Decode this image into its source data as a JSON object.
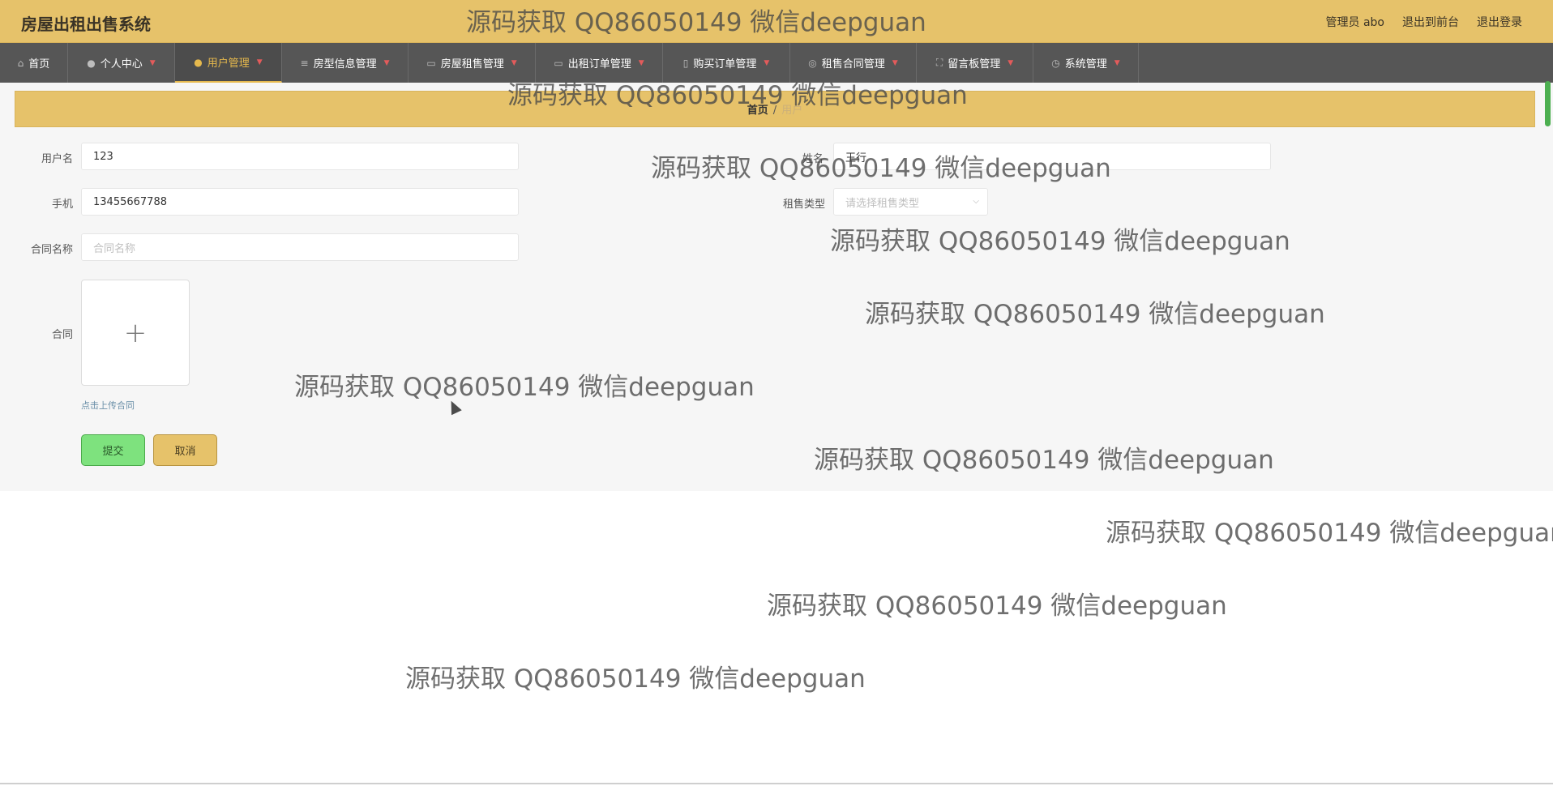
{
  "app": {
    "title": "房屋出租出售系统"
  },
  "top_links": {
    "admin": "管理员 abo",
    "to_front": "退出到前台",
    "logout": "退出登录"
  },
  "nav": [
    {
      "label": "首页",
      "icon": "home-icon",
      "glyph": "⌂"
    },
    {
      "label": "个人中心",
      "icon": "user-icon",
      "glyph": "●"
    },
    {
      "label": "用户管理",
      "icon": "user-icon",
      "glyph": "●",
      "active": true
    },
    {
      "label": "房型信息管理",
      "icon": "list-icon",
      "glyph": "≡"
    },
    {
      "label": "房屋租售管理",
      "icon": "chat-icon",
      "glyph": "▭"
    },
    {
      "label": "出租订单管理",
      "icon": "message-icon",
      "glyph": "▭"
    },
    {
      "label": "购买订单管理",
      "icon": "mic-icon",
      "glyph": "▯"
    },
    {
      "label": "租售合同管理",
      "icon": "compass-icon",
      "glyph": "◎"
    },
    {
      "label": "留言板管理",
      "icon": "fullscreen-icon",
      "glyph": "⛶"
    },
    {
      "label": "系统管理",
      "icon": "clock-icon",
      "glyph": "◷"
    }
  ],
  "breadcrumb": {
    "home": "首页",
    "sep": "/",
    "current": "用户"
  },
  "form": {
    "username_label": "用户名",
    "username_value": "123",
    "name_label": "姓名",
    "name_value": "王行",
    "phone_label": "手机",
    "phone_value": "13455667788",
    "rent_type_label": "租售类型",
    "rent_type_placeholder": "请选择租售类型",
    "contract_name_label": "合同名称",
    "contract_name_placeholder": "合同名称",
    "contract_label": "合同",
    "upload_tip": "点击上传合同",
    "submit": "提交",
    "cancel": "取消"
  },
  "watermark": "源码获取 QQ86050149 微信deepguan",
  "colors": {
    "accent": "#e6c26a",
    "nav_bg": "#565656",
    "submit": "#7ee27e"
  }
}
